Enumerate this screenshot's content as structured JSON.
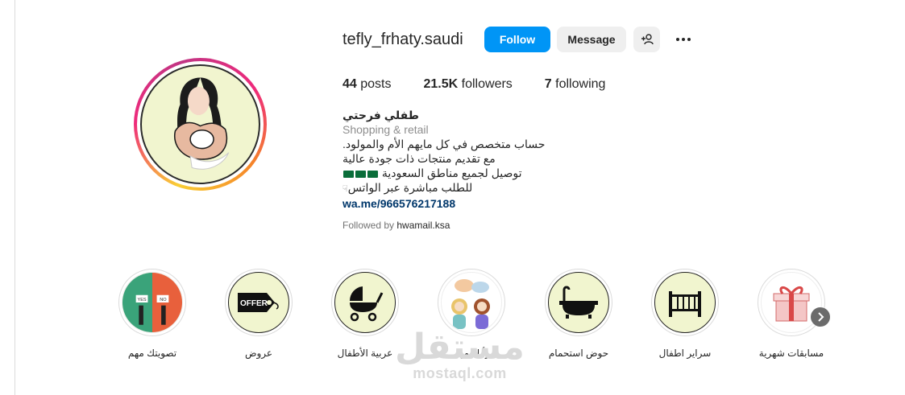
{
  "profile": {
    "username": "tefly_frhaty.saudi",
    "follow_label": "Follow",
    "message_label": "Message",
    "stats": {
      "posts_count": "44",
      "posts_label": "posts",
      "followers_count": "21.5K",
      "followers_label": "followers",
      "following_count": "7",
      "following_label": "following"
    },
    "bio": {
      "name": "طفلي فرحتي",
      "category": "Shopping & retail",
      "line1": "حساب متخصص في كل مايهم الأم والمولود.",
      "line2": "مع تقديم منتجات ذات جودة عالية",
      "line3": "توصيل لجميع مناطق السعودية",
      "line4": "للطلب مباشرة عبر الواتس",
      "link": "wa.me/966576217188"
    },
    "followed_by_prefix": "Followed by",
    "followed_by_user": "hwamail.ksa"
  },
  "highlights": [
    {
      "label": "مسابقات شهرية",
      "icon": "gift-icon"
    },
    {
      "label": "سراير اطفال",
      "icon": "crib-icon"
    },
    {
      "label": "حوض استحمام",
      "icon": "bathtub-icon"
    },
    {
      "label": "رأيك مهم",
      "icon": "chat-women-icon"
    },
    {
      "label": "عربية الأطفال",
      "icon": "stroller-icon"
    },
    {
      "label": "عروض",
      "icon": "offer-tag-icon"
    },
    {
      "label": "تصويتك مهم",
      "icon": "vote-yes-no-icon"
    }
  ],
  "watermark": {
    "arabic": "مستقل",
    "latin": "mostaql.com"
  },
  "colors": {
    "follow_button": "#0095f6",
    "link": "#00376b",
    "highlight_bg": "#f1f5cf"
  }
}
